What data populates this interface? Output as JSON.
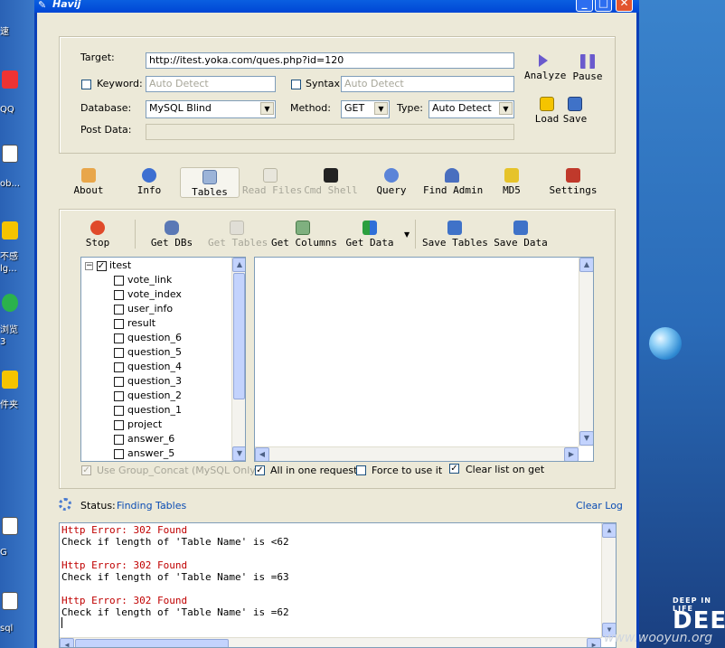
{
  "window": {
    "title": "Havij"
  },
  "desktop": {
    "left_labels": [
      "速",
      "QQ",
      "ob...",
      "不感",
      "lg...",
      "浏览",
      "3",
      "件夹",
      "G",
      "sql"
    ],
    "deep_small": "DEEP IN LIFE",
    "deep_big": "DEE",
    "watermark": "www.wooyun.org"
  },
  "target_panel": {
    "target_label": "Target:",
    "target_value": "http://itest.yoka.com/ques.php?id=120",
    "keyword_label": "Keyword:",
    "keyword_placeholder": "Auto Detect",
    "syntax_label": "Syntax:",
    "syntax_placeholder": "Auto Detect",
    "database_label": "Database:",
    "database_value": "MySQL Blind",
    "method_label": "Method:",
    "method_value": "GET",
    "type_label": "Type:",
    "type_value": "Auto Detect",
    "postdata_label": "Post Data:",
    "analyze_label": "Analyze",
    "pause_label": "Pause",
    "load_label": "Load",
    "save_label": "Save"
  },
  "main_tabs": [
    "About",
    "Info",
    "Tables",
    "Read Files",
    "Cmd Shell",
    "Query",
    "Find Admin",
    "MD5",
    "Settings"
  ],
  "table_toolbar": [
    "Stop",
    "Get DBs",
    "Get Tables",
    "Get Columns",
    "Get Data",
    "Save Tables",
    "Save Data"
  ],
  "tree": {
    "root": "itest",
    "items": [
      "vote_link",
      "vote_index",
      "user_info",
      "result",
      "question_6",
      "question_5",
      "question_4",
      "question_3",
      "question_2",
      "question_1",
      "project",
      "answer_6",
      "answer_5"
    ]
  },
  "options": {
    "group_concat": "Use Group_Concat (MySQL Only)",
    "all_in_one": "All in one request.",
    "force": "Force to use it",
    "clear_list": "Clear list on get"
  },
  "status": {
    "label": "Status:",
    "value": "Finding Tables",
    "clear_log": "Clear Log"
  },
  "log_lines": [
    {
      "text": "Http Error: 302 Found",
      "error": true
    },
    {
      "text": "Check if length of 'Table Name' is <62",
      "error": false
    },
    {
      "text": "",
      "error": false
    },
    {
      "text": "Http Error: 302 Found",
      "error": true
    },
    {
      "text": "Check if length of 'Table Name' is =63",
      "error": false
    },
    {
      "text": "",
      "error": false
    },
    {
      "text": "Http Error: 302 Found",
      "error": true
    },
    {
      "text": "Check if length of 'Table Name' is =62",
      "error": false
    }
  ],
  "colors": {
    "titlebar": "#0046d5",
    "window_bg": "#ece9d8",
    "error_text": "#c00000",
    "link": "#0a4cb4"
  }
}
